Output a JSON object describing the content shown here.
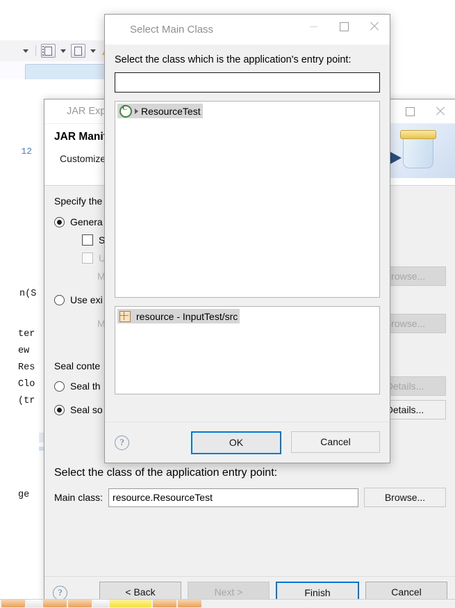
{
  "workbench": {
    "editor": {
      "line_number": "12",
      "code_fragments": [
        {
          "text": "n(S",
          "kind": "plain"
        },
        {
          "text": "ter",
          "kind": "italic"
        },
        {
          "text": "ew",
          "kind": "keyword"
        },
        {
          "text": "Res",
          "kind": "type"
        },
        {
          "text": "Clo",
          "kind": "plain"
        },
        {
          "text": "(tr",
          "kind": "keyword"
        },
        {
          "text": "ge",
          "kind": "link"
        }
      ]
    }
  },
  "wizard": {
    "title": "JAR Exp",
    "heading": "JAR Manif",
    "subtitle": "Customize",
    "specify_label": "Specify the",
    "options": {
      "generate_label": "Genera",
      "save_label": "Save",
      "use_label": "Use",
      "manifest_label_1": "Manife",
      "use_existing_label": "Use exi",
      "manifest_label_2": "Manife",
      "browse_1": "Browse...",
      "browse_2": "Browse..."
    },
    "seal": {
      "section_label": "Seal conte",
      "seal_the_label": "Seal th",
      "seal_some_label": "Seal so",
      "details_1": "Details...",
      "details_2": "Details..."
    },
    "main_class": {
      "prompt": "Select the class of the application entry point:",
      "label": "Main class:",
      "value": "resource.ResourceTest",
      "browse_label": "Browse..."
    },
    "footer": {
      "help": "?",
      "back": "< Back",
      "next": "Next >",
      "finish": "Finish",
      "cancel": "Cancel"
    }
  },
  "modal": {
    "title": "Select Main Class",
    "prompt": "Select the class which is the application's entry point:",
    "filter_value": "",
    "filter_placeholder": "",
    "classes": [
      {
        "label": "ResourceTest",
        "icon": "java-class-icon",
        "selected": true
      }
    ],
    "packages": [
      {
        "label": "resource - InputTest/src",
        "icon": "package-icon",
        "selected": true
      }
    ],
    "footer": {
      "help": "?",
      "ok": "OK",
      "cancel": "Cancel"
    }
  },
  "colors": {
    "accent_focus": "#0078d7",
    "dialog_bg": "#f0f0f0",
    "selection": "#d6d6d6",
    "class_icon_green": "#3f8a3f",
    "package_icon_orange": "#c07a35",
    "keyword_magenta": "#b0197f",
    "type_blue": "#3b4fd0",
    "lineno_blue": "#4a7ebb"
  }
}
